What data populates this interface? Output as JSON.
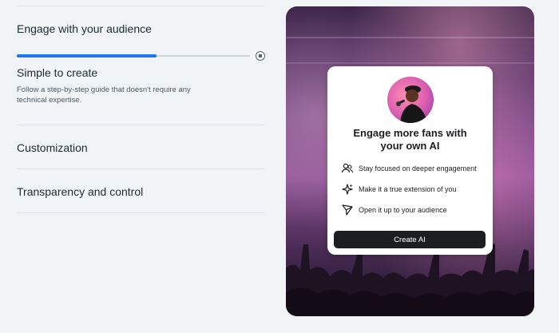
{
  "sections": [
    {
      "title": "Engage with your audience"
    },
    {
      "title": "Simple to create",
      "description_line1": "Follow a step-by-step guide that doesn't require any",
      "description_line2": "technical expertise."
    },
    {
      "title": "Customization"
    },
    {
      "title": "Transparency and control"
    }
  ],
  "progress": {
    "fraction": 0.6
  },
  "card": {
    "title_line1": "Engage more fans with",
    "title_line2": "your own AI",
    "features": [
      {
        "icon": "people-icon",
        "label": "Stay focused on deeper engagement"
      },
      {
        "icon": "sparkle-icon",
        "label": "Make it a true extension of you"
      },
      {
        "icon": "send-icon",
        "label": "Open it up to your audience"
      }
    ],
    "cta_label": "Create AI"
  },
  "colors": {
    "accent": "#1877f2",
    "background": "#f1f4f7",
    "button": "#1c1e21"
  }
}
